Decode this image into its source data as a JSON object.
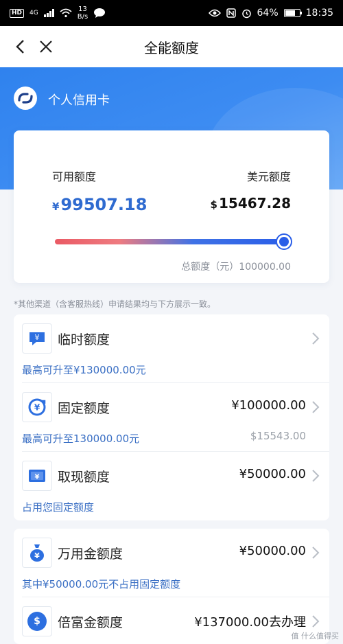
{
  "status": {
    "hd": "HD",
    "net": "4G",
    "speed_num": "13",
    "speed_unit": "B/s",
    "battery": "64%",
    "time": "18:35"
  },
  "nav": {
    "title": "全能额度"
  },
  "card": {
    "bank_name": "个人信用卡"
  },
  "quota": {
    "available_label": "可用额度",
    "available_currency": "¥",
    "available_value": "99507.18",
    "usd_label": "美元额度",
    "usd_currency": "$",
    "usd_value": "15467.28",
    "usage_fraction": 0.995,
    "total_text": "总额度（元）100000.00"
  },
  "note": "*其他渠道（含客服热线）申请结果均与下方展示一致。",
  "items": [
    {
      "title": "临时额度",
      "amount": "",
      "sub": "最高可升至¥130000.00元",
      "sub_right": ""
    },
    {
      "title": "固定额度",
      "amount": "¥100000.00",
      "sub": "最高可升至130000.00元",
      "sub_right": "$15543.00"
    },
    {
      "title": "取现额度",
      "amount": "¥50000.00",
      "sub": "占用您固定额度",
      "sub_right": ""
    },
    {
      "title": "万用金额度",
      "amount": "¥50000.00",
      "sub": "其中¥50000.00元不占用固定额度",
      "sub_right": ""
    },
    {
      "title": "倍富金额度",
      "amount": "¥137000.00去办理",
      "sub": "",
      "sub_right": ""
    }
  ],
  "watermark": "值 什么值得买",
  "colors": {
    "accent": "#2f6bd0",
    "hero": "#3d8cf2",
    "slider_start": "#ea5a64",
    "slider_end": "#2a5ee8"
  }
}
